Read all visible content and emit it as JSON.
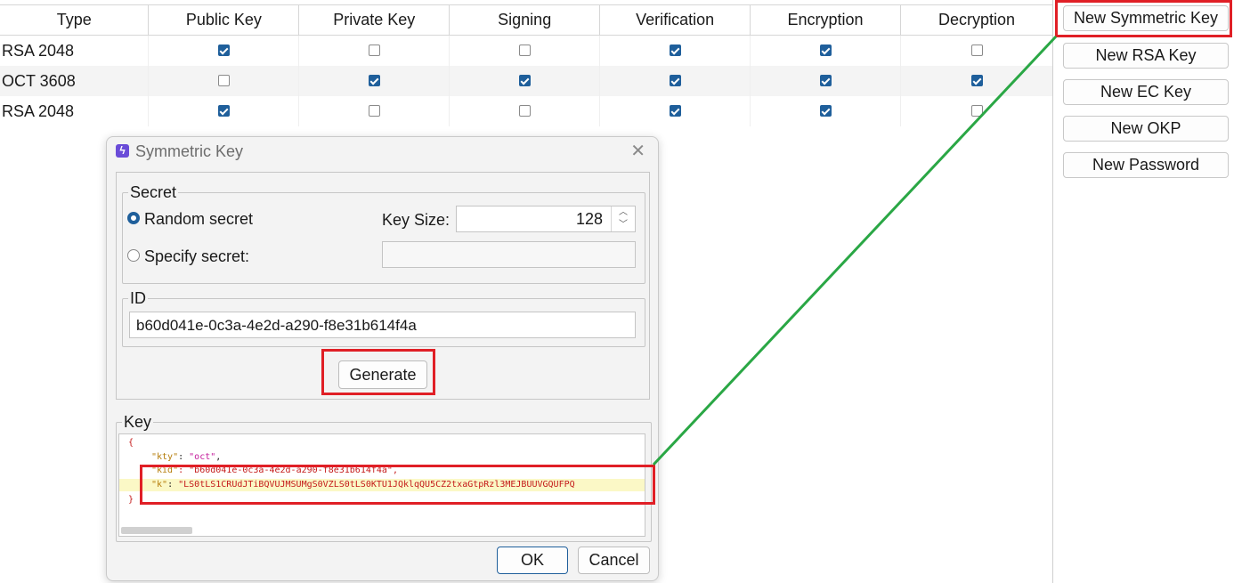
{
  "table": {
    "headers": [
      "Type",
      "Public Key",
      "Private Key",
      "Signing",
      "Verification",
      "Encryption",
      "Decryption"
    ],
    "rows": [
      {
        "type": "RSA 2048",
        "public": true,
        "private": false,
        "signing": false,
        "verification": true,
        "encryption": true,
        "decryption": false
      },
      {
        "type": "OCT 3608",
        "public": false,
        "private": true,
        "signing": true,
        "verification": true,
        "encryption": true,
        "decryption": true
      },
      {
        "type": "RSA 2048",
        "public": true,
        "private": false,
        "signing": false,
        "verification": true,
        "encryption": true,
        "decryption": false
      }
    ]
  },
  "side_buttons": [
    "New Symmetric Key",
    "New RSA Key",
    "New EC Key",
    "New OKP",
    "New Password"
  ],
  "dialog": {
    "title": "Symmetric Key",
    "secret_group": "Secret",
    "random_secret": "Random secret",
    "specify_secret": "Specify secret:",
    "key_size_label": "Key Size:",
    "key_size_value": "128",
    "specify_secret_value": "",
    "id_group": "ID",
    "id_value": "b60d041e-0c3a-4e2d-a290-f8e31b614f4a",
    "generate": "Generate",
    "key_group": "Key",
    "key_json": {
      "open": "{",
      "kty_key": "\"kty\"",
      "kty_val": "\"oct\"",
      "kid_key": "\"kid\"",
      "kid_val": "\"b60d041e-0c3a-4e2d-a290-f8e31b614f4a\"",
      "k_key": "\"k\"",
      "k_val": "\"LS0tLS1CRUdJTiBQVUJMSUMgS0VZLS0tLS0KTU1JQklqQU5CZ2txaGtpRzl3MEJBUUVGQUFPQ",
      "close": "}"
    },
    "ok": "OK",
    "cancel": "Cancel"
  },
  "colors": {
    "highlight": "#e01f26",
    "connector": "#2aa745",
    "checkbox_on": "#1f5f9b"
  }
}
